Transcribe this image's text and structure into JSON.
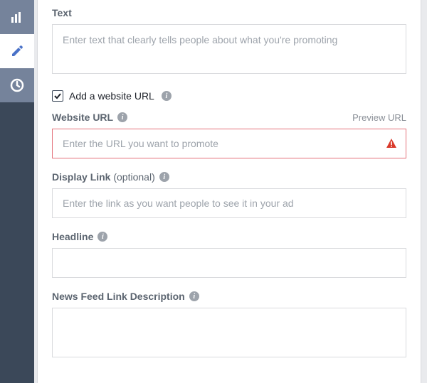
{
  "sidebar": {
    "items": [
      {
        "name": "analytics"
      },
      {
        "name": "edit"
      },
      {
        "name": "history"
      }
    ]
  },
  "form": {
    "text": {
      "label": "Text",
      "placeholder": "Enter text that clearly tells people about what you're promoting"
    },
    "addUrlCheckbox": {
      "label": "Add a website URL",
      "checked": true
    },
    "websiteUrl": {
      "label": "Website URL",
      "previewLink": "Preview URL",
      "placeholder": "Enter the URL you want to promote"
    },
    "displayLink": {
      "label": "Display Link",
      "optional": "(optional)",
      "placeholder": "Enter the link as you want people to see it in your ad"
    },
    "headline": {
      "label": "Headline",
      "value": ""
    },
    "newsFeedDesc": {
      "label": "News Feed Link Description",
      "value": ""
    }
  }
}
